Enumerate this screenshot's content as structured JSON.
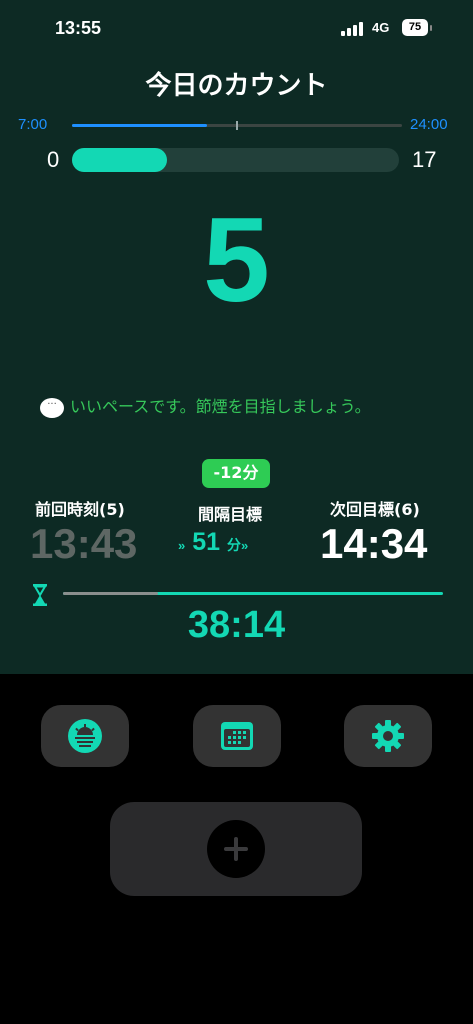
{
  "status_bar": {
    "time": "13:55",
    "network": "4G",
    "battery": "75"
  },
  "title": "今日のカウント",
  "timeline": {
    "start": "7:00",
    "end": "24:00",
    "progress": 0.41
  },
  "count_bar": {
    "min": "0",
    "max": "17",
    "current": 5,
    "fraction": 0.29
  },
  "big_count": "5",
  "message": "いいペースです。節煙を目指しましょう。",
  "badge": "-12分",
  "previous": {
    "label": "前回時刻(5)",
    "time": "13:43"
  },
  "interval": {
    "label": "間隔目標",
    "value": "51",
    "unit": "分",
    "chevron": "»"
  },
  "next": {
    "label": "次回目標(6)",
    "time": "14:34"
  },
  "timer": {
    "remaining": "38:14",
    "elapsed_fraction": 0.25
  },
  "toolbar": {
    "icons": [
      "sunrise-icon",
      "calendar-icon",
      "gear-icon",
      "plus-icon"
    ]
  },
  "colors": {
    "accent": "#13d8b4",
    "background_top": "#0d2a24",
    "timeline_blue": "#1e90ff",
    "message_green": "#36c85a",
    "badge_green": "#2ecc54"
  }
}
